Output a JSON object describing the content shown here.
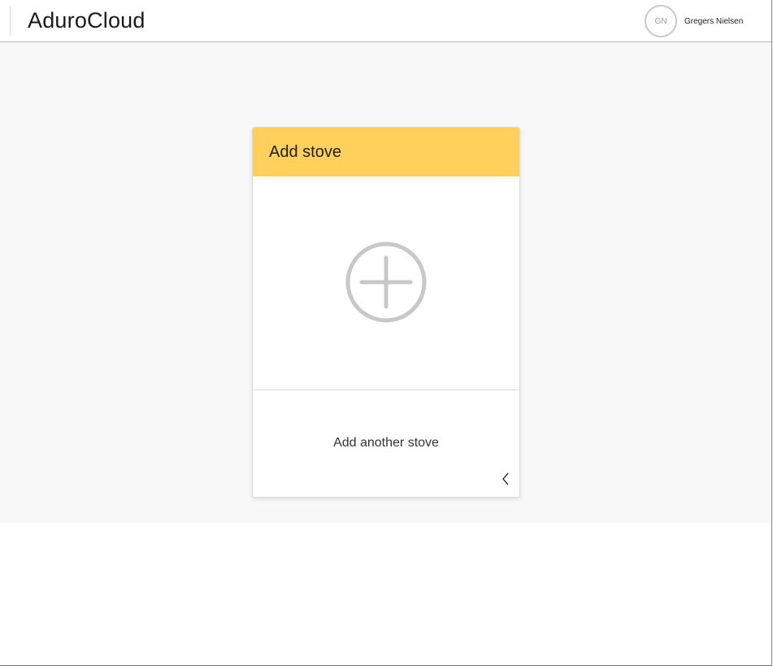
{
  "header": {
    "app_title": "AduroCloud",
    "user": {
      "initials": "GN",
      "name": "Gregers Nielsen"
    }
  },
  "card": {
    "title": "Add stove",
    "add_icon": "plus-circle-icon",
    "footer_text": "Add another stove",
    "chevron_icon": "chevron-left-icon"
  },
  "colors": {
    "card_header": "#ffd15c",
    "content_background": "#f8f8f8",
    "icon_gray": "#c8c8c8"
  }
}
